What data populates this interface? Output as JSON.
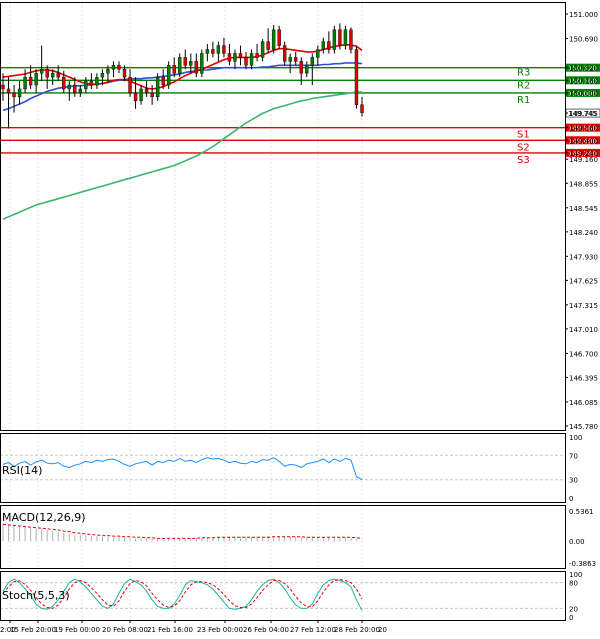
{
  "chart_data": [
    {
      "type": "candlestick",
      "panel": "price",
      "yticks": [
        "151.000",
        "150.690",
        "150.320",
        "150.160",
        "150.000",
        "149.745",
        "149.560",
        "149.400",
        "149.240",
        "149.160",
        "148.855",
        "148.545",
        "148.240",
        "147.930",
        "147.625",
        "147.315",
        "147.010",
        "146.700",
        "146.395",
        "146.085",
        "145.780"
      ],
      "ylim": [
        145.78,
        151.0
      ],
      "current_price": "149.745",
      "levels": [
        {
          "label": "R3",
          "value": 150.32,
          "color": "#008000"
        },
        {
          "label": "R2",
          "value": 150.16,
          "color": "#008000"
        },
        {
          "label": "R1",
          "value": 150.0,
          "color": "#008000"
        },
        {
          "label": "S1",
          "value": 149.56,
          "color": "#e00000"
        },
        {
          "label": "S2",
          "value": 149.4,
          "color": "#e00000"
        },
        {
          "label": "S3",
          "value": 149.24,
          "color": "#e00000"
        }
      ],
      "candles": [
        [
          150.1,
          150.25,
          149.9,
          150.05
        ],
        [
          150.05,
          150.2,
          149.55,
          150.0
        ],
        [
          150.0,
          150.1,
          149.75,
          149.95
        ],
        [
          149.95,
          150.15,
          149.85,
          150.05
        ],
        [
          150.05,
          150.3,
          150.0,
          150.2
        ],
        [
          150.2,
          150.35,
          150.05,
          150.1
        ],
        [
          150.1,
          150.3,
          150.0,
          150.25
        ],
        [
          150.25,
          150.6,
          150.15,
          150.3
        ],
        [
          150.3,
          150.35,
          150.05,
          150.2
        ],
        [
          150.2,
          150.3,
          150.1,
          150.25
        ],
        [
          150.25,
          150.35,
          150.15,
          150.2
        ],
        [
          150.2,
          150.28,
          150.0,
          150.05
        ],
        [
          150.05,
          150.15,
          149.9,
          150.1
        ],
        [
          150.1,
          150.2,
          149.95,
          150.0
        ],
        [
          150.0,
          150.1,
          149.95,
          150.05
        ],
        [
          150.05,
          150.2,
          150.0,
          150.15
        ],
        [
          150.15,
          150.25,
          150.05,
          150.1
        ],
        [
          150.1,
          150.25,
          150.05,
          150.2
        ],
        [
          150.2,
          150.3,
          150.1,
          150.25
        ],
        [
          150.25,
          150.35,
          150.15,
          150.3
        ],
        [
          150.3,
          150.4,
          150.2,
          150.35
        ],
        [
          150.35,
          150.4,
          150.25,
          150.3
        ],
        [
          150.3,
          150.35,
          150.15,
          150.2
        ],
        [
          150.2,
          150.3,
          149.95,
          150.0
        ],
        [
          150.0,
          150.2,
          149.8,
          149.9
        ],
        [
          149.9,
          150.1,
          149.85,
          150.05
        ],
        [
          150.05,
          150.15,
          149.95,
          150.0
        ],
        [
          150.0,
          150.1,
          149.85,
          149.95
        ],
        [
          149.95,
          150.25,
          149.9,
          150.2
        ],
        [
          150.2,
          150.3,
          150.05,
          150.1
        ],
        [
          150.1,
          150.4,
          150.05,
          150.35
        ],
        [
          150.35,
          150.45,
          150.2,
          150.25
        ],
        [
          150.25,
          150.5,
          150.2,
          150.45
        ],
        [
          150.45,
          150.55,
          150.3,
          150.35
        ],
        [
          150.35,
          150.5,
          150.25,
          150.4
        ],
        [
          150.4,
          150.5,
          150.2,
          150.25
        ],
        [
          150.25,
          150.55,
          150.2,
          150.5
        ],
        [
          150.5,
          150.62,
          150.4,
          150.55
        ],
        [
          150.55,
          150.65,
          150.45,
          150.5
        ],
        [
          150.5,
          150.65,
          150.4,
          150.6
        ],
        [
          150.6,
          150.7,
          150.45,
          150.5
        ],
        [
          150.5,
          150.62,
          150.35,
          150.4
        ],
        [
          150.4,
          150.55,
          150.3,
          150.5
        ],
        [
          150.5,
          150.6,
          150.35,
          150.45
        ],
        [
          150.45,
          150.52,
          150.3,
          150.35
        ],
        [
          150.35,
          150.55,
          150.3,
          150.5
        ],
        [
          150.5,
          150.62,
          150.4,
          150.45
        ],
        [
          150.45,
          150.68,
          150.4,
          150.65
        ],
        [
          150.65,
          150.82,
          150.5,
          150.55
        ],
        [
          150.55,
          150.86,
          150.5,
          150.8
        ],
        [
          150.8,
          150.85,
          150.55,
          150.6
        ],
        [
          150.6,
          150.65,
          150.35,
          150.4
        ],
        [
          150.4,
          150.5,
          150.25,
          150.45
        ],
        [
          150.45,
          150.52,
          150.35,
          150.4
        ],
        [
          150.4,
          150.45,
          150.1,
          150.25
        ],
        [
          150.25,
          150.4,
          150.2,
          150.35
        ],
        [
          150.35,
          150.5,
          150.1,
          150.45
        ],
        [
          150.45,
          150.6,
          150.35,
          150.55
        ],
        [
          150.55,
          150.7,
          150.5,
          150.65
        ],
        [
          150.65,
          150.78,
          150.5,
          150.55
        ],
        [
          150.55,
          150.85,
          150.5,
          150.8
        ],
        [
          150.8,
          150.88,
          150.55,
          150.6
        ],
        [
          150.6,
          150.85,
          150.55,
          150.8
        ],
        [
          150.8,
          150.83,
          150.5,
          150.55
        ],
        [
          150.55,
          150.6,
          149.8,
          149.85
        ],
        [
          149.85,
          149.95,
          149.7,
          149.75
        ]
      ],
      "ma_fast": [
        150.2,
        150.21,
        150.22,
        150.23,
        150.24,
        150.26,
        150.28,
        150.29,
        150.29,
        150.28,
        150.26,
        150.23,
        150.2,
        150.17,
        150.14,
        150.12,
        150.11,
        150.11,
        150.12,
        150.14,
        150.16,
        150.17,
        150.17,
        150.15,
        150.12,
        150.09,
        150.06,
        150.05,
        150.06,
        150.08,
        150.11,
        150.14,
        150.18,
        150.22,
        150.25,
        150.28,
        150.3,
        150.33,
        150.36,
        150.39,
        150.42,
        150.44,
        150.45,
        150.45,
        150.45,
        150.45,
        150.46,
        150.48,
        150.51,
        150.54,
        150.56,
        150.56,
        150.55,
        150.54,
        150.53,
        150.52,
        150.52,
        150.53,
        150.55,
        150.57,
        150.59,
        150.6,
        150.61,
        150.61,
        150.59,
        150.54
      ],
      "ma_mid": [
        149.78,
        149.8,
        149.83,
        149.86,
        149.89,
        149.93,
        149.96,
        149.99,
        150.02,
        150.04,
        150.06,
        150.07,
        150.08,
        150.09,
        150.09,
        150.1,
        150.1,
        150.11,
        150.12,
        150.13,
        150.15,
        150.16,
        150.17,
        150.18,
        150.18,
        150.18,
        150.19,
        150.19,
        150.2,
        150.21,
        150.22,
        150.23,
        150.24,
        150.26,
        150.27,
        150.28,
        150.29,
        150.29,
        150.3,
        150.31,
        150.32,
        150.32,
        150.32,
        150.32,
        150.32,
        150.32,
        150.32,
        150.33,
        150.33,
        150.34,
        150.35,
        150.35,
        150.35,
        150.35,
        150.35,
        150.35,
        150.35,
        150.35,
        150.36,
        150.36,
        150.37,
        150.37,
        150.38,
        150.38,
        150.38,
        150.37
      ],
      "ma_slow": [
        148.4,
        148.43,
        148.46,
        148.49,
        148.52,
        148.55,
        148.58,
        148.6,
        148.62,
        148.64,
        148.66,
        148.68,
        148.7,
        148.72,
        148.74,
        148.76,
        148.78,
        148.8,
        148.82,
        148.84,
        148.86,
        148.88,
        148.9,
        148.92,
        148.94,
        148.96,
        148.98,
        149.0,
        149.02,
        149.04,
        149.06,
        149.08,
        149.11,
        149.14,
        149.17,
        149.2,
        149.24,
        149.28,
        149.32,
        149.37,
        149.42,
        149.47,
        149.52,
        149.57,
        149.62,
        149.66,
        149.7,
        149.74,
        149.77,
        149.8,
        149.82,
        149.84,
        149.86,
        149.88,
        149.9,
        149.91,
        149.93,
        149.94,
        149.95,
        149.96,
        149.97,
        149.98,
        149.99,
        150.0,
        150.01,
        150.01
      ]
    },
    {
      "type": "line",
      "panel": "rsi",
      "label": "RSI(14)",
      "yticks": [
        "100",
        "70",
        "30",
        "0"
      ],
      "ylim": [
        0,
        100
      ],
      "values": [
        55,
        58,
        52,
        57,
        60,
        54,
        59,
        62,
        57,
        56,
        58,
        52,
        50,
        54,
        56,
        60,
        58,
        62,
        60,
        63,
        64,
        60,
        55,
        52,
        56,
        58,
        60,
        54,
        60,
        58,
        62,
        60,
        65,
        60,
        62,
        58,
        63,
        66,
        64,
        65,
        62,
        58,
        60,
        57,
        56,
        60,
        58,
        63,
        62,
        66,
        60,
        52,
        55,
        54,
        50,
        56,
        58,
        60,
        64,
        58,
        64,
        60,
        65,
        62,
        35,
        30
      ]
    },
    {
      "type": "bar",
      "panel": "macd",
      "label": "MACD(12,26,9)",
      "yticks": [
        "0.5361",
        "0.00",
        "-0.3863"
      ],
      "ylim": [
        -0.3863,
        0.5361
      ],
      "histogram": [
        0.3,
        0.28,
        0.27,
        0.26,
        0.25,
        0.24,
        0.23,
        0.22,
        0.2,
        0.18,
        0.17,
        0.15,
        0.13,
        0.12,
        0.11,
        0.1,
        0.09,
        0.09,
        0.08,
        0.08,
        0.07,
        0.07,
        0.06,
        0.06,
        0.05,
        0.05,
        0.05,
        0.04,
        0.04,
        0.04,
        0.04,
        0.04,
        0.05,
        0.05,
        0.06,
        0.06,
        0.06,
        0.07,
        0.07,
        0.08,
        0.08,
        0.08,
        0.08,
        0.08,
        0.08,
        0.08,
        0.08,
        0.08,
        0.09,
        0.09,
        0.09,
        0.09,
        0.08,
        0.08,
        0.07,
        0.07,
        0.07,
        0.07,
        0.07,
        0.07,
        0.07,
        0.07,
        0.07,
        0.06,
        0.03,
        0.01
      ],
      "signal": [
        0.3,
        0.29,
        0.28,
        0.27,
        0.26,
        0.25,
        0.24,
        0.23,
        0.22,
        0.21,
        0.2,
        0.18,
        0.17,
        0.15,
        0.14,
        0.13,
        0.12,
        0.11,
        0.1,
        0.1,
        0.09,
        0.09,
        0.08,
        0.08,
        0.07,
        0.07,
        0.06,
        0.06,
        0.05,
        0.05,
        0.05,
        0.05,
        0.05,
        0.05,
        0.05,
        0.05,
        0.06,
        0.06,
        0.06,
        0.07,
        0.07,
        0.07,
        0.07,
        0.07,
        0.07,
        0.07,
        0.07,
        0.07,
        0.07,
        0.08,
        0.08,
        0.08,
        0.08,
        0.08,
        0.08,
        0.07,
        0.07,
        0.07,
        0.07,
        0.07,
        0.07,
        0.07,
        0.07,
        0.07,
        0.06,
        0.05
      ]
    },
    {
      "type": "line",
      "panel": "stoch",
      "label": "Stoch(5,5,3)",
      "yticks": [
        "100",
        "80",
        "20",
        "0"
      ],
      "ylim": [
        0,
        100
      ],
      "main": [
        60,
        80,
        88,
        80,
        65,
        50,
        30,
        20,
        18,
        25,
        40,
        60,
        80,
        88,
        82,
        70,
        55,
        40,
        25,
        20,
        30,
        55,
        78,
        88,
        82,
        75,
        60,
        40,
        25,
        20,
        20,
        30,
        50,
        75,
        85,
        82,
        80,
        75,
        65,
        50,
        35,
        20,
        18,
        20,
        25,
        40,
        60,
        75,
        85,
        88,
        80,
        65,
        45,
        28,
        20,
        20,
        30,
        55,
        75,
        85,
        88,
        85,
        80,
        70,
        40,
        15
      ],
      "signal": [
        55,
        70,
        82,
        84,
        76,
        62,
        45,
        30,
        22,
        20,
        28,
        45,
        65,
        80,
        85,
        80,
        68,
        55,
        40,
        28,
        25,
        38,
        60,
        78,
        85,
        82,
        72,
        55,
        40,
        28,
        22,
        25,
        38,
        58,
        75,
        82,
        82,
        80,
        75,
        65,
        52,
        38,
        26,
        22,
        22,
        30,
        45,
        62,
        75,
        85,
        85,
        78,
        65,
        48,
        33,
        24,
        24,
        38,
        58,
        75,
        85,
        87,
        85,
        80,
        65,
        42
      ]
    }
  ],
  "x_axis": {
    "ticks": [
      "2:00",
      "15 Feb 20:00",
      "19 Feb 00:00",
      "20 Feb 08:00",
      "21 Feb 16:00",
      "23 Feb 00:00",
      "26 Feb 04:00",
      "27 Feb 12:00",
      "28 Feb 20:00"
    ],
    "last_label": "20"
  },
  "colors": {
    "bull": "#008000",
    "bear": "#e00000",
    "ma_fast": "#e00000",
    "ma_mid": "#3050d0",
    "ma_slow": "#3cb371",
    "support": "#e00000",
    "resistance": "#008000",
    "indicator": "#1e90ff"
  }
}
